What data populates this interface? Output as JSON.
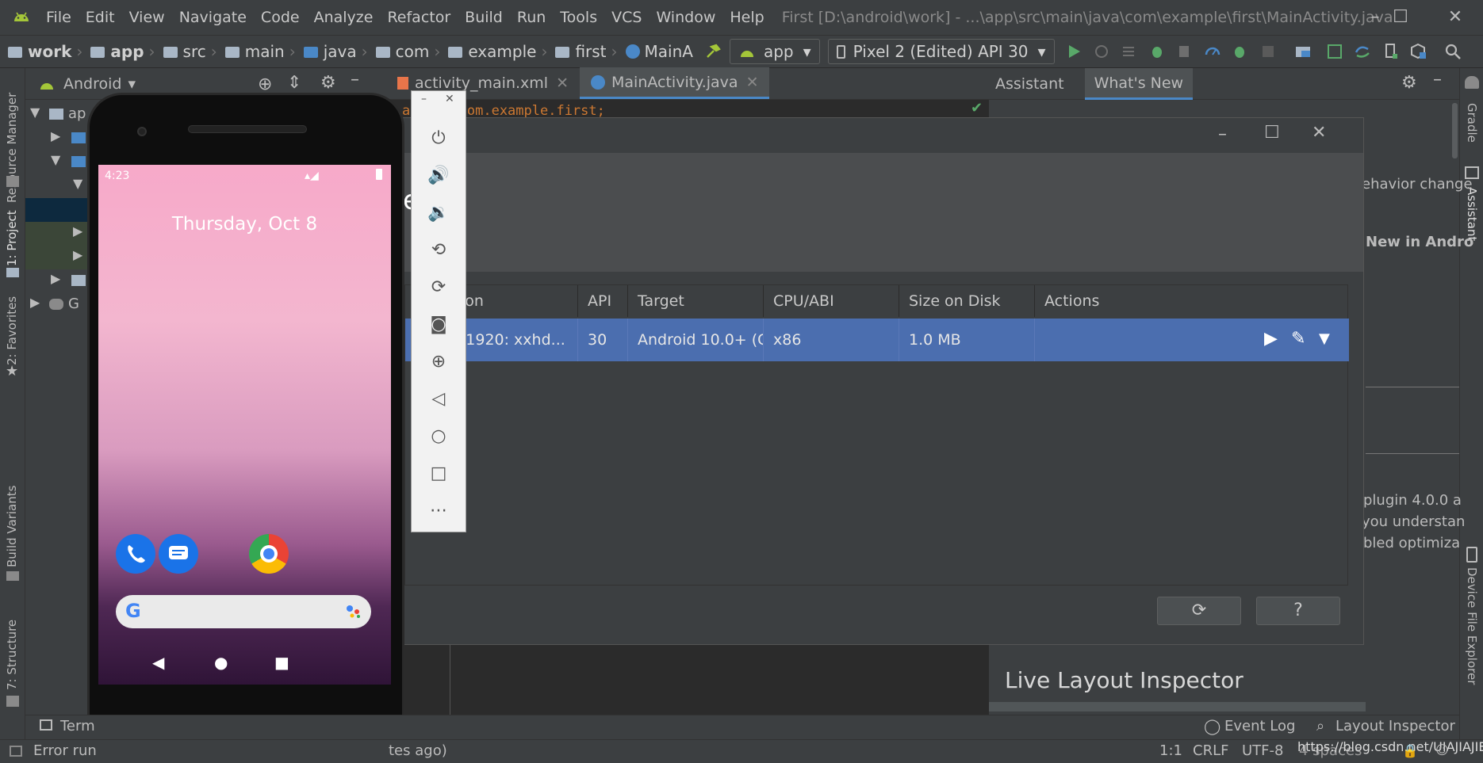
{
  "menubar": {
    "items": [
      "File",
      "Edit",
      "View",
      "Navigate",
      "Code",
      "Analyze",
      "Refactor",
      "Build",
      "Run",
      "Tools",
      "VCS",
      "Window",
      "Help"
    ],
    "title": "First [D:\\android\\work] - ...\\app\\src\\main\\java\\com\\example\\first\\MainActivity.java"
  },
  "navbar": {
    "crumbs": [
      "work",
      "app",
      "src",
      "main",
      "java",
      "com",
      "example",
      "first",
      "MainA"
    ],
    "run_config": "app",
    "device": "Pixel 2 (Edited) API 30"
  },
  "left_tools": {
    "resource_manager": "Resource Manager",
    "project": "1: Project",
    "favorites": "2: Favorites",
    "build_variants": "Build Variants",
    "structure": "7: Structure"
  },
  "right_tools": {
    "gradle": "Gradle",
    "assistant": "Assistant",
    "device_file_explorer": "Device File Explorer"
  },
  "project_panel": {
    "view": "Android",
    "row_a": "ap",
    "row_g": "G"
  },
  "editor": {
    "tabs": [
      "activity_main.xml",
      "MainActivity.java"
    ],
    "code_line1": "ackage com.example.first;"
  },
  "assistant": {
    "tabs": [
      "Assistant",
      "What's New"
    ],
    "text1": "ehavior change",
    "text2": "New in Andro",
    "text3": "plugin 4.0.0 a",
    "text4": "you understan",
    "text5": "bled optimiza",
    "live_layout": "Live Layout Inspector"
  },
  "avd_manager": {
    "header_fragment": "es",
    "columns": [
      "esolution",
      "API",
      "Target",
      "CPU/ABI",
      "Size on Disk",
      "Actions"
    ],
    "row": {
      "resolution": "080 × 1920: xxhd...",
      "api": "30",
      "target": "Android 10.0+ (Go...",
      "cpu": "x86",
      "size": "1.0 MB"
    },
    "refresh_button": "⟳",
    "help_button": "?"
  },
  "phone": {
    "time": "4:23",
    "date": "Thursday, Oct 8"
  },
  "bottom_tools": {
    "terminal": "Term",
    "event_log": "Event Log",
    "layout_inspector": "Layout Inspector"
  },
  "statusbar": {
    "message_left": "Error run",
    "message_right": "tes ago)",
    "position": "1:1",
    "line_sep": "CRLF",
    "encoding": "UTF-8",
    "indent": "4 spaces",
    "watermark": "https://blog.csdn.net/UIAJIAJIE"
  },
  "colors": {
    "ide_bg": "#2b2b2b",
    "panel": "#3c3f41",
    "selection": "#4b6eaf",
    "android_green": "#a4c639"
  }
}
